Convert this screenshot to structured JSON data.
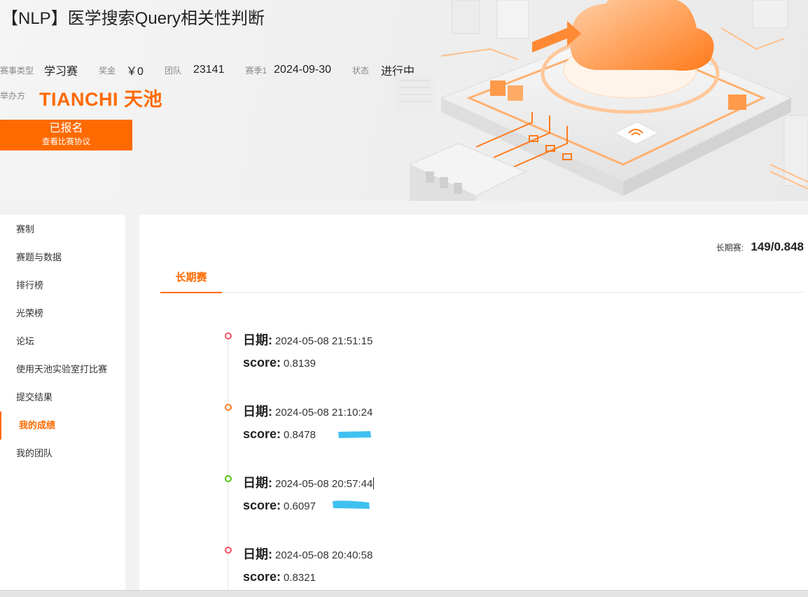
{
  "banner": {
    "title": "【NLP】医学搜索Query相关性判断",
    "meta": [
      {
        "label": "赛事类型",
        "value": "学习赛"
      },
      {
        "label": "奖金",
        "value": "￥0"
      },
      {
        "label": "团队",
        "value": "23141"
      },
      {
        "label": "赛季1",
        "value": "2024-09-30"
      },
      {
        "label": "状态",
        "value": "进行中"
      }
    ],
    "organizer_label": "举办方",
    "organizer_logo": "TIANCHI 天池",
    "signup": {
      "main": "已报名",
      "sub": "查看比赛协议"
    }
  },
  "sidebar": {
    "items": [
      {
        "label": "赛制"
      },
      {
        "label": "赛题与数据"
      },
      {
        "label": "排行榜"
      },
      {
        "label": "光荣榜"
      },
      {
        "label": "论坛"
      },
      {
        "label": "使用天池实验室打比赛"
      },
      {
        "label": "提交结果"
      },
      {
        "label": "我的成绩",
        "active": true
      },
      {
        "label": "我的团队"
      }
    ]
  },
  "main": {
    "summary_label": "长期赛:",
    "summary_value": "149/0.848",
    "tab": "长期赛",
    "date_key": "日期:",
    "score_key": "score:",
    "entries": [
      {
        "date": "2024-05-08 21:51:15",
        "score": "0.8139",
        "dot_color": "#f5515f"
      },
      {
        "date": "2024-05-08 21:10:24",
        "score": "0.8478",
        "dot_color": "#ff7a1a"
      },
      {
        "date": "2024-05-08 20:57:44",
        "score": "0.6097",
        "dot_color": "#52c41a"
      },
      {
        "date": "2024-05-08 20:40:58",
        "score": "0.8321",
        "dot_color": "#f5515f"
      }
    ]
  },
  "colors": {
    "accent": "#ff6a00",
    "scribble": "#3fc1f0"
  }
}
